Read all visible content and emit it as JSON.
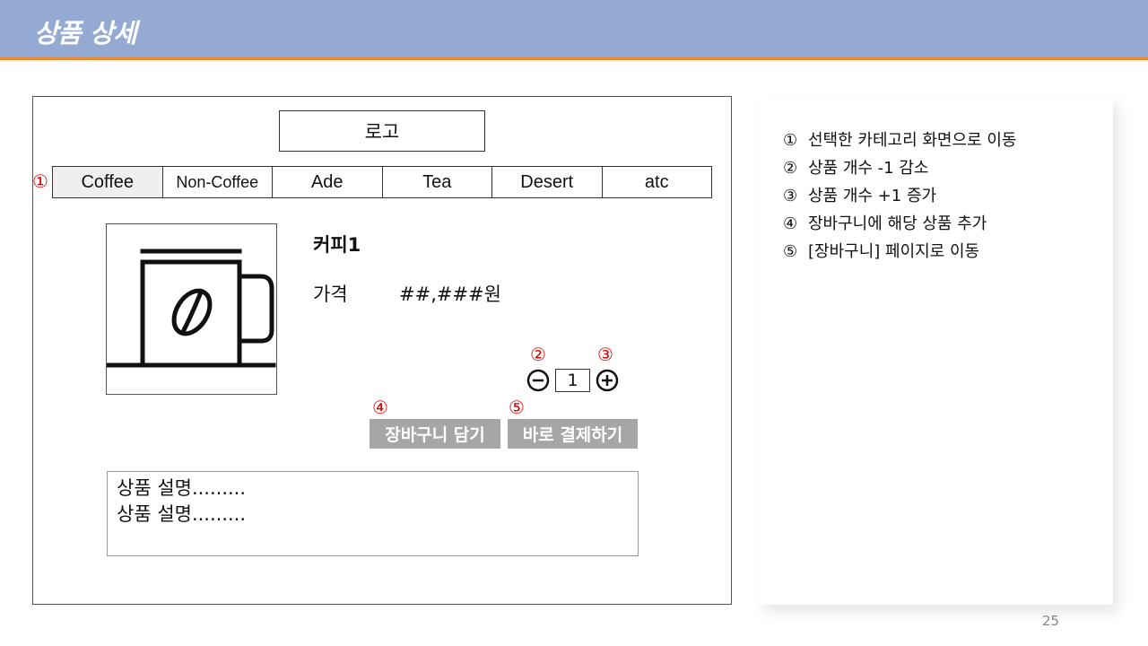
{
  "header": {
    "title": "상품 상세"
  },
  "wireframe": {
    "logo": "로고",
    "nav_items": [
      "Coffee",
      "Non-Coffee",
      "Ade",
      "Tea",
      "Desert",
      "atc"
    ],
    "product": {
      "name": "커피1",
      "price_label": "가격",
      "price_value": "##,###원",
      "image_icon": "coffee-mug-icon"
    },
    "quantity": {
      "value": "1"
    },
    "buttons": {
      "cart": "장바구니 담기",
      "buy": "바로 결제하기"
    },
    "description_lines": [
      "상품 설명.........",
      "상품 설명........."
    ],
    "markers": [
      "①",
      "②",
      "③",
      "④",
      "⑤"
    ]
  },
  "notes": [
    {
      "num": "①",
      "text": "선택한 카테고리 화면으로 이동"
    },
    {
      "num": "②",
      "text": "상품 개수 -1 감소"
    },
    {
      "num": "③",
      "text": "상품 개수 +1 증가"
    },
    {
      "num": "④",
      "text": "장바구니에 해당 상품 추가"
    },
    {
      "num": "⑤",
      "text": "[장바구니] 페이지로 이동"
    }
  ],
  "page_number": "25",
  "colors": {
    "header_bg": "#95aad3",
    "header_border": "#f0862c",
    "marker": "#e00000",
    "button_bg": "#a6a6a6"
  }
}
